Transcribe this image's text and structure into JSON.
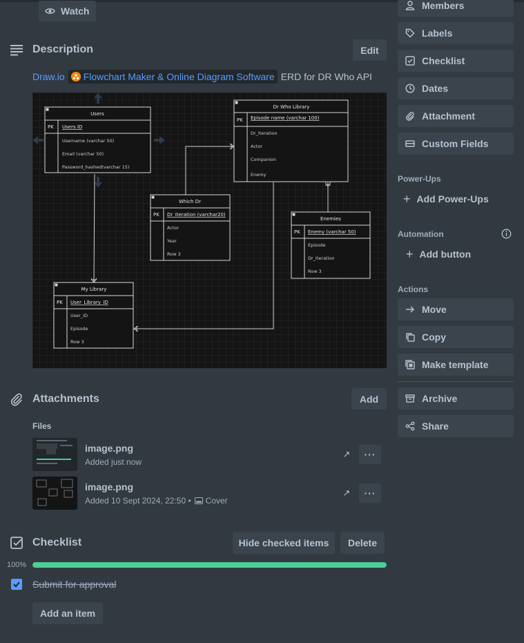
{
  "watch_label": "Watch",
  "sidebar": {
    "actions_top": [
      {
        "label": "Members",
        "icon": "person-icon"
      },
      {
        "label": "Labels",
        "icon": "tag-icon"
      },
      {
        "label": "Checklist",
        "icon": "checklist-icon"
      },
      {
        "label": "Dates",
        "icon": "clock-icon"
      },
      {
        "label": "Attachment",
        "icon": "paperclip-icon"
      },
      {
        "label": "Custom Fields",
        "icon": "custom-fields-icon"
      }
    ],
    "powerups_heading": "Power-Ups",
    "add_powerups": "Add Power-Ups",
    "automation_heading": "Automation",
    "add_button": "Add button",
    "actions_heading": "Actions",
    "actions": [
      {
        "label": "Move",
        "icon": "arrow-right-icon"
      },
      {
        "label": "Copy",
        "icon": "copy-icon"
      },
      {
        "label": "Make template",
        "icon": "template-icon"
      },
      {
        "label": "Archive",
        "icon": "archive-icon"
      },
      {
        "label": "Share",
        "icon": "share-icon"
      }
    ]
  },
  "description": {
    "title": "Description",
    "edit_label": "Edit",
    "link_text": "Draw.io",
    "chip_text": "Flowchart Maker & Online Diagram Software",
    "trailing_text": "ERD for DR Who API"
  },
  "erd": {
    "tables": {
      "users": {
        "title": "Users",
        "pk": "PK",
        "key": "Users ID",
        "rows": [
          "Username (varchar 50)",
          "Email (varchar 50)",
          "Password_hashed(varchar 15)"
        ]
      },
      "drwho": {
        "title": "Dr Who Library",
        "pk": "PK",
        "key": "Episode name (varchar 100)",
        "rows": [
          "Dr_Iteration",
          "Actor",
          "Companion",
          "Enemy"
        ]
      },
      "whichdr": {
        "title": "Which Dr",
        "pk": "PK",
        "key": "Dr_Iteration (varchar20)",
        "rows": [
          "Actor",
          "Year",
          "Row 3"
        ]
      },
      "enemies": {
        "title": "Enemies",
        "pk": "PK",
        "key": "Enemy (varchar 50)",
        "rows": [
          "Episode",
          "Dr_Iteration",
          "Row 3"
        ]
      },
      "mylib": {
        "title": "My Library",
        "pk": "PK",
        "key": "User_Library_ID",
        "rows": [
          "User_ID",
          "Episode",
          "Row 3"
        ]
      }
    }
  },
  "attachments": {
    "title": "Attachments",
    "add_label": "Add",
    "files_label": "Files",
    "files": [
      {
        "name": "image.png",
        "meta": "Added just now",
        "cover": ""
      },
      {
        "name": "image.png",
        "meta": "Added 10 Sept 2024, 22:50 •",
        "cover": "Cover"
      }
    ],
    "more": "···",
    "open": "↗"
  },
  "checklist": {
    "title": "Checklist",
    "hide_label": "Hide checked items",
    "delete_label": "Delete",
    "progress_text": "100%",
    "progress": 1.0,
    "items": [
      {
        "text": "Submit for approval",
        "checked": true
      }
    ],
    "add_item": "Add an item"
  },
  "colors": {
    "accent": "#579dff",
    "progress": "#4bce97",
    "background": "#323940",
    "button": "#3b444c"
  }
}
